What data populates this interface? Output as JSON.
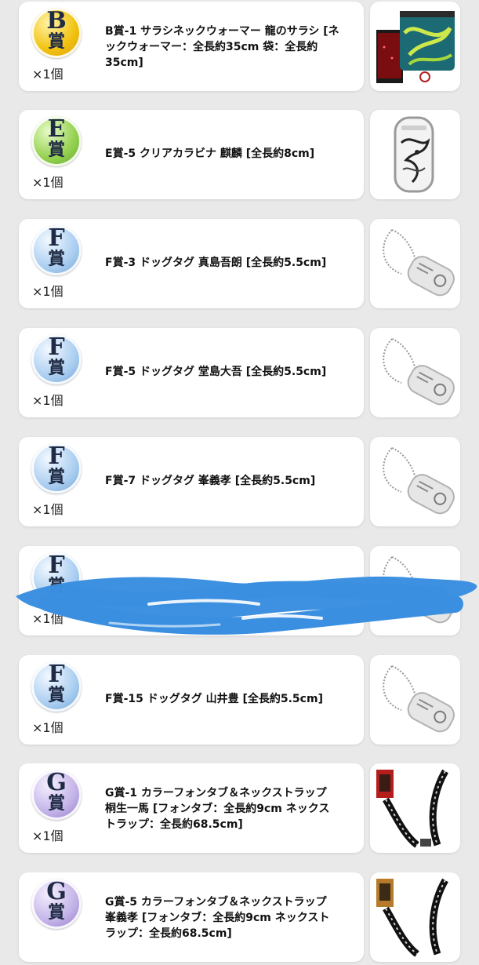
{
  "colors": {
    "B": "#f2c312",
    "E": "#92cf4c",
    "F": "#a9cdf0",
    "G": "#c2b2e7",
    "redaction": "#3a8fe0"
  },
  "items": [
    {
      "grade_letter": "B",
      "grade_kanji": "賞",
      "title": "B賞-1 サラシネックウォーマー 龍のサラシ [ネックウォーマー：全長約35cm 袋：全長約35cm]",
      "qty": "×1個",
      "thumb": "neck-warmer"
    },
    {
      "grade_letter": "E",
      "grade_kanji": "賞",
      "title": "E賞-5 クリアカラビナ 麒麟 [全長約8cm]",
      "qty": "×1個",
      "thumb": "carabiner"
    },
    {
      "grade_letter": "F",
      "grade_kanji": "賞",
      "title": "F賞-3 ドッグタグ 真島吾朗 [全長約5.5cm]",
      "qty": "×1個",
      "thumb": "dogtag"
    },
    {
      "grade_letter": "F",
      "grade_kanji": "賞",
      "title": "F賞-5 ドッグタグ 堂島大吾 [全長約5.5cm]",
      "qty": "×1個",
      "thumb": "dogtag"
    },
    {
      "grade_letter": "F",
      "grade_kanji": "賞",
      "title": "F賞-7 ドッグタグ 峯義孝 [全長約5.5cm]",
      "qty": "×1個",
      "thumb": "dogtag"
    },
    {
      "grade_letter": "F",
      "grade_kanji": "賞",
      "title": "",
      "qty": "×1個",
      "thumb": "dogtag",
      "redacted": true
    },
    {
      "grade_letter": "F",
      "grade_kanji": "賞",
      "title": "F賞-15 ドッグタグ 山井豊 [全長約5.5cm]",
      "qty": "×1個",
      "thumb": "dogtag"
    },
    {
      "grade_letter": "G",
      "grade_kanji": "賞",
      "title": "G賞-1 カラーフォンタブ＆ネックストラップ 桐生一馬 [フォンタブ：全長約9cm ネックストラップ：全長約68.5cm]",
      "qty": "×1個",
      "thumb": "strap"
    },
    {
      "grade_letter": "G",
      "grade_kanji": "賞",
      "title": "G賞-5 カラーフォンタブ＆ネックストラップ 峯義孝 [フォンタブ：全長約9cm ネックストラップ：全長約68.5cm]",
      "qty": "",
      "thumb": "strap"
    }
  ]
}
